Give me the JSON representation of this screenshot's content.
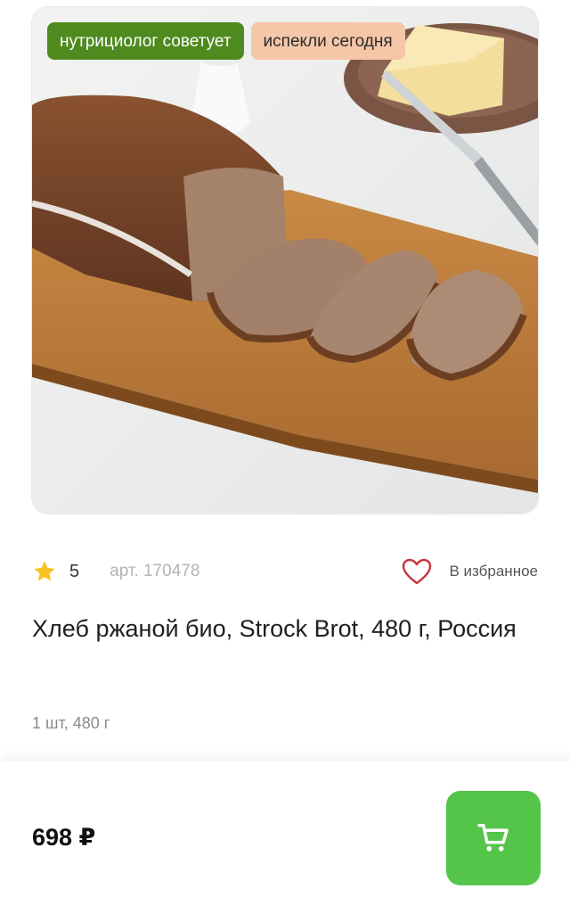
{
  "product": {
    "image_alt": "rye bread loaf on wooden board",
    "badges": [
      "нутрициолог советует",
      "испекли сегодня"
    ],
    "rating": "5",
    "sku": "арт. 170478",
    "favorite_label": "В избранное",
    "title": "Хлеб ржаной био, Strock Brot, 480 г, Россия",
    "unit": "1 шт, 480 г",
    "price": "698 ₽"
  },
  "colors": {
    "badge_green": "#4f8a1f",
    "badge_peach": "#f5c6a8",
    "star": "#f6c21c",
    "heart": "#c9343b",
    "cart_button": "#55c54a"
  },
  "icons": {
    "rating": "star-icon",
    "favorite": "heart-icon",
    "cart": "cart-icon"
  }
}
